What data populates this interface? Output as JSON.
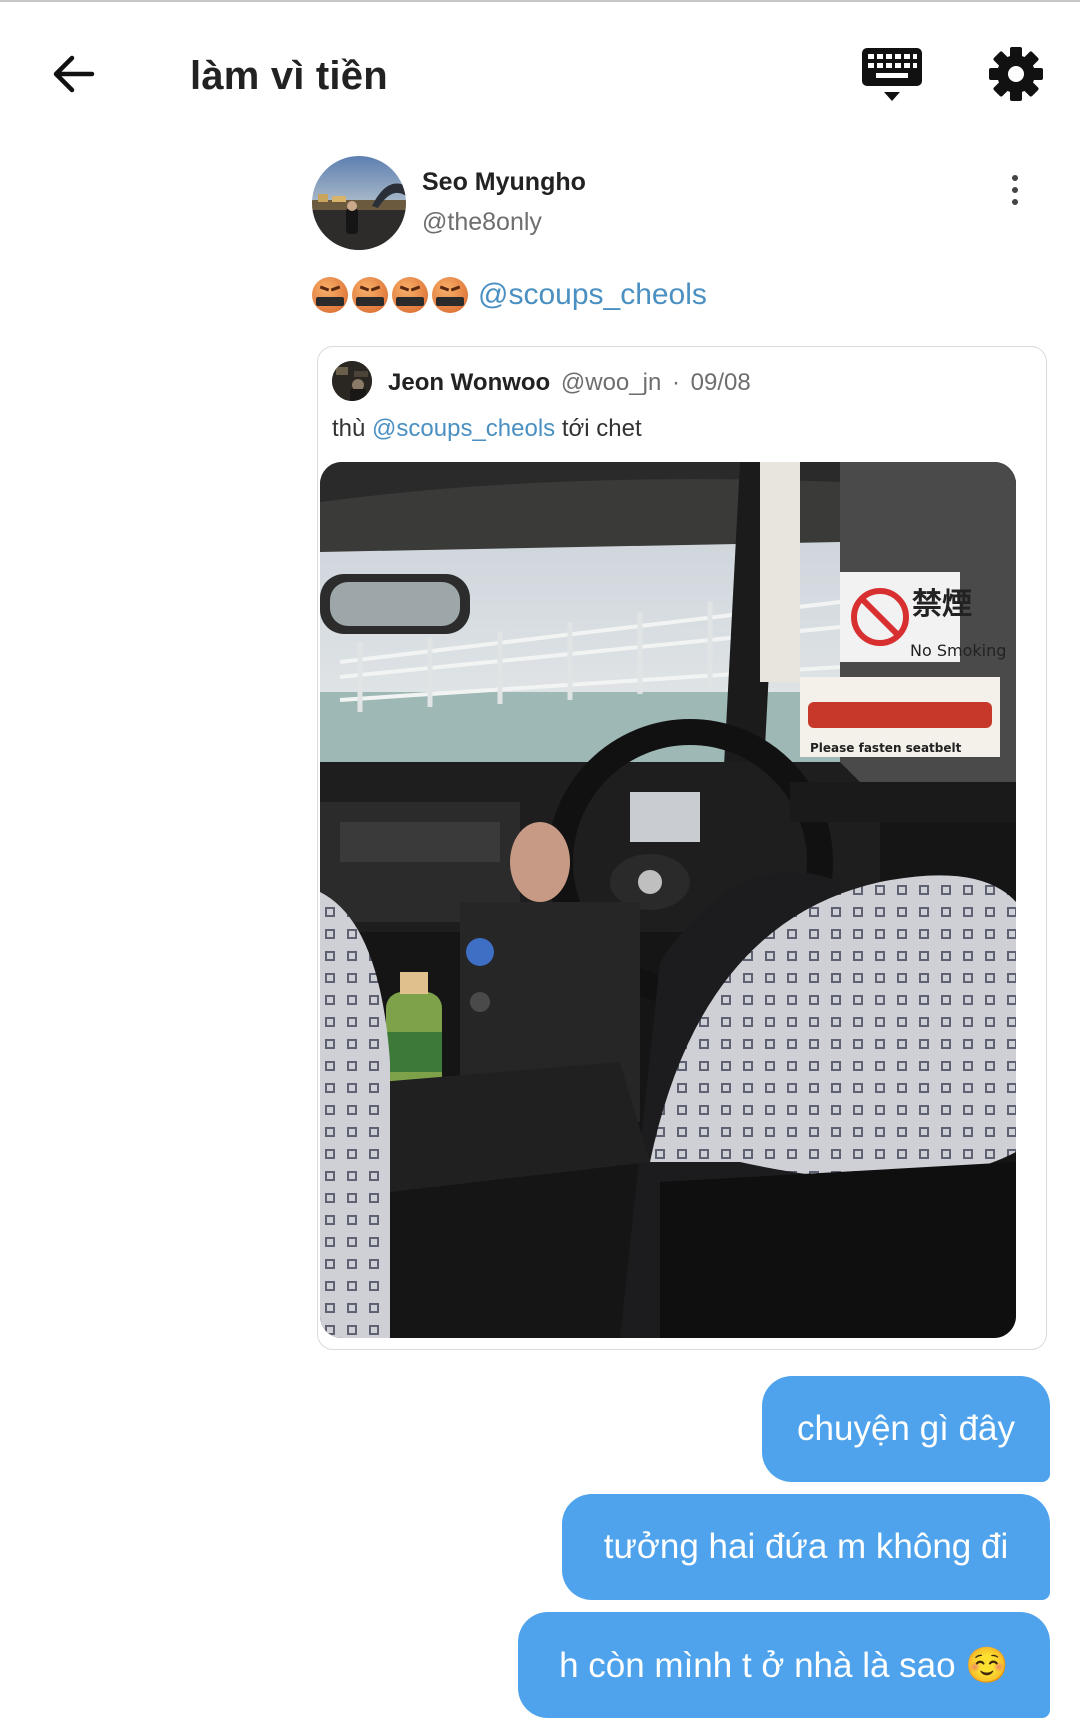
{
  "header": {
    "title": "làm vì tiền",
    "back_icon": "arrow-left-icon",
    "keyboard_icon": "keyboard-icon",
    "settings_icon": "gear-icon"
  },
  "tweet": {
    "author_name": "Seo Myungho",
    "author_handle": "@the8only",
    "emojis": [
      "face-with-symbols-on-mouth",
      "face-with-symbols-on-mouth",
      "face-with-symbols-on-mouth",
      "face-with-symbols-on-mouth"
    ],
    "mention": "@scoups_cheols",
    "quote": {
      "author_name": "Jeon Wonwoo",
      "author_handle": "@woo_jn",
      "separator": "·",
      "date": "09/08",
      "text_before": "thù",
      "mention": "@scoups_cheols",
      "text_after": "tới chet",
      "photo_signs": {
        "no_smoking_kanji": "禁煙",
        "no_smoking": "No Smoking",
        "seatbelt": "Please fasten seatbelt"
      }
    }
  },
  "messages": [
    {
      "text": "chuyện gì đây"
    },
    {
      "text": "tưởng hai đứa m không đi"
    },
    {
      "text": "h còn mình t ở nhà là sao ☺️"
    }
  ],
  "colors": {
    "bubble": "#4ea3ec",
    "mention": "#4a90c2"
  }
}
